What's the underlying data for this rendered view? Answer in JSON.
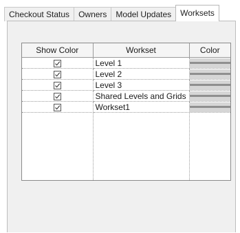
{
  "tabs": [
    {
      "label": "Checkout Status",
      "active": false
    },
    {
      "label": "Owners",
      "active": false
    },
    {
      "label": "Model Updates",
      "active": false
    },
    {
      "label": "Worksets",
      "active": true
    }
  ],
  "grid": {
    "headers": {
      "show_color": "Show Color",
      "workset": "Workset",
      "color": "Color"
    },
    "rows": [
      {
        "show_color": true,
        "workset": "Level 1"
      },
      {
        "show_color": true,
        "workset": "Level 2"
      },
      {
        "show_color": true,
        "workset": "Level 3"
      },
      {
        "show_color": true,
        "workset": "Shared Levels and Grids"
      },
      {
        "show_color": true,
        "workset": "Workset1"
      }
    ]
  }
}
